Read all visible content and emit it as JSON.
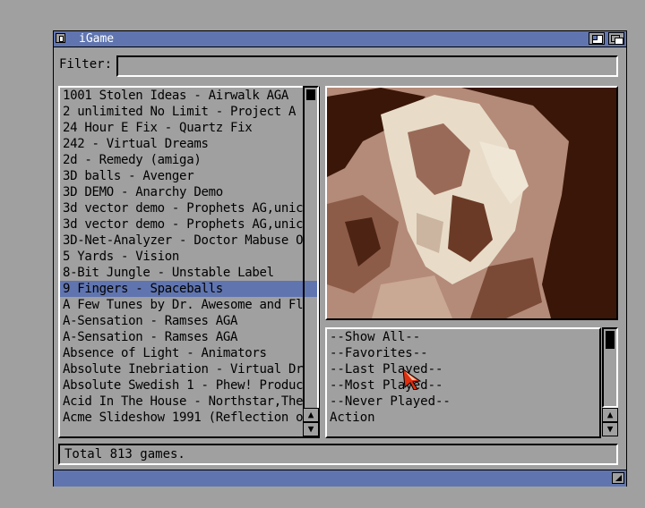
{
  "window": {
    "title": "iGame"
  },
  "filter": {
    "label": "Filter:",
    "value": ""
  },
  "games": [
    "1001 Stolen Ideas - Airwalk AGA",
    "2 unlimited No Limit - Project A",
    "24 Hour E Fix - Quartz Fix",
    "242 - Virtual Dreams",
    "2d - Remedy (amiga)",
    "3D balls - Avenger",
    "3D DEMO - Anarchy Demo",
    "3d vector demo - Prophets AG,unic",
    "3d vector demo - Prophets AG,unic",
    "3D-Net-Analyzer - Doctor Mabuse O",
    "5 Yards - Vision",
    "8-Bit Jungle - Unstable Label",
    "9 Fingers - Spaceballs",
    "A Few Tunes by Dr. Awesome and Fl",
    "A-Sensation - Ramses AGA",
    "A-Sensation - Ramses AGA",
    "Absence of Light - Animators",
    "Absolute Inebriation - Virtual Dr",
    "Absolute Swedish 1 - Phew! Produc",
    "Acid In The House - Northstar,The",
    "Acme Slideshow 1991 (Reflection o"
  ],
  "selected_game_index": 12,
  "categories": [
    "--Show All--",
    "--Favorites--",
    "--Last Played--",
    "--Most Played--",
    "--Never Played--",
    "Action"
  ],
  "status": {
    "text": "Total 813 games."
  },
  "colors": {
    "window_bg": "#a0a0a0",
    "titlebar": "#6075b0",
    "selection": "#6075b0",
    "screenshot_bg": "#b48a78",
    "screenshot_dark": "#3a1608"
  },
  "icons": {
    "close": "close-gadget-icon",
    "zoom": "zoom-gadget-icon",
    "depth": "depth-gadget-icon",
    "arrow_up": "▲",
    "arrow_down": "▼"
  }
}
